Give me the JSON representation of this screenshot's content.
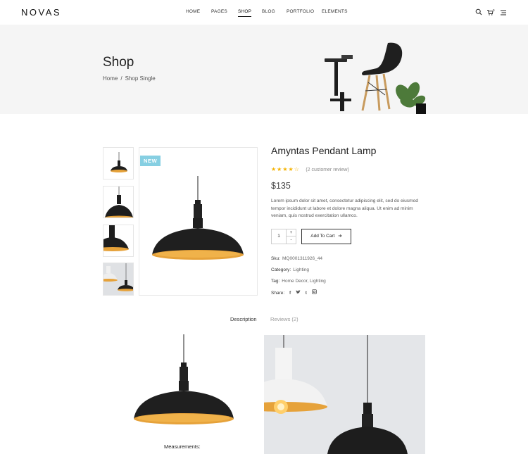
{
  "header": {
    "logo": "NOVAS",
    "nav": [
      {
        "label": "HOME"
      },
      {
        "label": "PAGES"
      },
      {
        "label": "SHOP"
      },
      {
        "label": "BLOG"
      },
      {
        "label": "PORTFOLIO"
      },
      {
        "label": "ELEMENTS"
      }
    ],
    "active_nav": "SHOP",
    "cart_count": "0",
    "icons": [
      "search-icon",
      "cart-icon",
      "menu-icon"
    ]
  },
  "banner": {
    "title": "Shop",
    "breadcrumb": [
      {
        "label": "Home"
      },
      {
        "label": "Shop Single"
      }
    ],
    "separator": "/"
  },
  "gallery": {
    "badge": "NEW",
    "thumbnails": [
      "lamp-thumb-1",
      "lamp-thumb-2",
      "lamp-thumb-3",
      "lamp-photo-thumb"
    ]
  },
  "product": {
    "title": "Amyntas Pendant Lamp",
    "rating": 4,
    "rating_max": 5,
    "review_text": "(2 customer review)",
    "price": "$135",
    "description": "Lorem ipsum dolor sit amet, consectetur adipiscing elit, sed do eiusmod tempor incididunt ut labore et dolore magna aliqua. Ut enim ad minim veniam, quis nostrud exercitation ullamco.",
    "quantity": "1",
    "qty_up": "+",
    "qty_down": "-",
    "add_to_cart": "Add To Cart",
    "sku_label": "Sku:",
    "sku": "MQ0001311926_44",
    "category_label": "Category:",
    "category": "Lighting",
    "tag_label": "Tag:",
    "tags": "Home Decor, Lighting",
    "share_label": "Share:",
    "share_icons": [
      "facebook-icon",
      "twitter-icon",
      "tumblr-icon",
      "instagram-icon"
    ]
  },
  "tabs": [
    {
      "label": "Description"
    },
    {
      "label": "Reviews (2)"
    }
  ],
  "active_tab": "Description",
  "content": {
    "measurements_label": "Measurements:"
  },
  "colors": {
    "accent_badge": "#86cfe2",
    "star": "#f5b301",
    "banner_bg": "#f5f5f5",
    "lamp_shade": "#1e1e1e",
    "lamp_inside": "#e6a23a"
  }
}
